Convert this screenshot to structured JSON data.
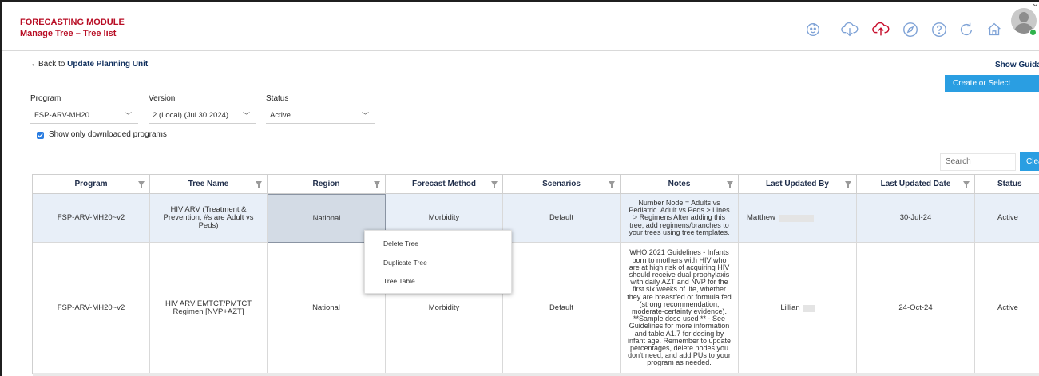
{
  "header": {
    "module_title": "FORECASTING MODULE",
    "page_title": "Manage Tree – Tree list",
    "icons": [
      "baby-icon",
      "sync-down-icon",
      "cloud-upload-icon",
      "compass-icon",
      "help-icon",
      "refresh-icon",
      "home-icon",
      "avatar-icon"
    ],
    "accent_color": "#b80d24",
    "icon_color": "#7ea2d6",
    "upload_icon_color": "#c8102e"
  },
  "nav": {
    "back_arrow": "←",
    "back_text": "Back to ",
    "back_target": "Update Planning Unit",
    "show_guidance": "Show Guidance",
    "create_or_select": "Create or Select"
  },
  "filters": {
    "program_label": "Program",
    "program_value": "FSP-ARV-MH20",
    "version_label": "Version",
    "version_value": "2 (Local) (Jul 30 2024)",
    "status_label": "Status",
    "status_value": "Active",
    "downloaded_only_label": "Show only downloaded programs",
    "downloaded_only_checked": true
  },
  "search": {
    "placeholder": "Search",
    "clear_label": "Clear"
  },
  "table": {
    "headers": [
      "Program",
      "Tree Name",
      "Region",
      "Forecast Method",
      "Scenarios",
      "Notes",
      "Last Updated By",
      "Last Updated Date",
      "Status"
    ],
    "rows": [
      {
        "program": "FSP-ARV-MH20~v2",
        "tree_name": "HIV ARV (Treatment & Prevention, #s are Adult vs Peds)",
        "region": "National",
        "forecast_method": "Morbidity",
        "scenarios": "Default",
        "notes": "Number Node = Adults vs Pediatric. Adult vs Peds > Lines > Regimens After adding this tree, add regimens/branches to your trees using tree templates.",
        "last_updated_by": "Matthew",
        "last_updated_date": "30-Jul-24",
        "status": "Active"
      },
      {
        "program": "FSP-ARV-MH20~v2",
        "tree_name": "HIV ARV EMTCT/PMTCT Regimen [NVP+AZT]",
        "region": "National",
        "forecast_method": "Morbidity",
        "scenarios": "Default",
        "notes": "WHO 2021 Guidelines - Infants born to mothers with HIV who are at high risk of acquiring HIV should receive dual prophylaxis with daily AZT and NVP for the first six weeks of life, whether they are breastfed or formula fed (strong recommendation, moderate-certainty evidence). **Sample dose used ** - See Guidelines for more information and table A1.7 for dosing by infant age. Remember to update percentages, delete nodes you don't need, and add PUs to your program as needed.",
        "last_updated_by": "Lillian",
        "last_updated_date": "24-Oct-24",
        "status": "Active"
      }
    ]
  },
  "context_menu": {
    "items": [
      "Delete Tree",
      "Duplicate Tree",
      "Tree Table"
    ]
  }
}
